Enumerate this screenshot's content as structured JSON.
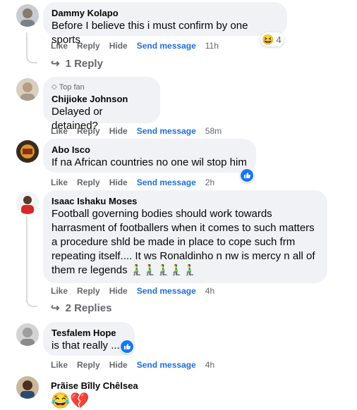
{
  "actions": {
    "like": "Like",
    "reply": "Reply",
    "hide": "Hide",
    "send": "Send message"
  },
  "comments": [
    {
      "name": "Dammy Kolapo",
      "text": "Before I believe this i must confirm by one sports",
      "time": "11h",
      "reaction_count": "4",
      "reaction_icon": "laughing-emoji",
      "replies": "1 Reply"
    },
    {
      "badge": "Top fan",
      "name": "Chijioke Johnson",
      "text": "Delayed or detained?",
      "time": "58m"
    },
    {
      "name": "Abo Isco",
      "text": "If na African countries no one wil stop him",
      "time": "2h",
      "reaction_icon": "like-thumb"
    },
    {
      "name": "Isaac Ishaku Moses",
      "lines": [
        "Football governing bodies should work towards",
        "harrasment of footballers when it comes to such matters",
        "a procedure shld be made in place to cope such frm",
        "repeating itself.... It ws Ronaldinho n nw is mercy n all of",
        "them re legends 🧎‍♂️🧎‍♂️🧎‍♂️🧎‍♂️🧎‍♂️"
      ],
      "time": "4h",
      "replies": "2 Replies"
    },
    {
      "name": "Tesfalem Hope",
      "text": "is that really ...",
      "time": "4h",
      "reaction_icon": "like-thumb"
    },
    {
      "name": "Prãise Bîlly Chêlsea",
      "text": "😂💔"
    }
  ],
  "colors": {
    "bubble": "#f0f2f5",
    "link": "#216fdb",
    "muted": "#65676b",
    "like_blue": "#1877f2"
  }
}
